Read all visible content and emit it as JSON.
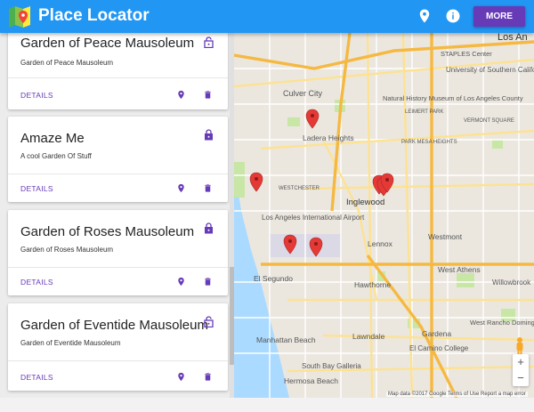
{
  "app": {
    "title": "Place Locator",
    "more_label": "MORE",
    "icons": [
      "map-logo-icon",
      "place-icon",
      "info-icon"
    ]
  },
  "cards": [
    {
      "title": "Garden of Peace Mausoleum",
      "subtitle": "Garden of Peace Mausoleum",
      "details_label": "DETAILS",
      "lock": "lock-open"
    },
    {
      "title": "Amaze Me",
      "subtitle": "A cool Garden Of Stuff",
      "details_label": "DETAILS",
      "lock": "lock"
    },
    {
      "title": "Garden of Roses Mausoleum",
      "subtitle": "Garden of Roses Mausoleum",
      "details_label": "DETAILS",
      "lock": "lock"
    },
    {
      "title": "Garden of Eventide Mausoleum",
      "subtitle": "Garden of Eventide Mausoleum",
      "details_label": "DETAILS",
      "lock": "lock-open"
    }
  ],
  "map": {
    "labels": {
      "los_angeles": "Los An",
      "university": "University of Southern California",
      "staples": "STAPLES Center",
      "culver": "Culver City",
      "nhm": "Natural History Museum of Los Angeles County",
      "ladera": "Ladera Heights",
      "inglewood": "Inglewood",
      "westchester": "WESTCHESTER",
      "lax": "Los Angeles International Airport",
      "lennox": "Lennox",
      "westmont": "Westmont",
      "elsegundo": "El Segundo",
      "hawthorne": "Hawthorne",
      "westathens": "West Athens",
      "willowbrook": "Willowbrook",
      "westrancho": "West Rancho Dominguez",
      "manhattan": "Manhattan Beach",
      "lawndale": "Lawndale",
      "gardena": "Gardena",
      "elcamino": "El Camino College",
      "southbay": "South Bay Galleria",
      "hermosa": "Hermosa Beach",
      "leimert": "LEIMERT PARK",
      "vermont": "VERMONT SQUARE",
      "parkmesa": "PARK MESA HEIGHTS"
    },
    "attribution": "Map data ©2017 Google    Terms of Use    Report a map error",
    "zoom_in": "+",
    "zoom_out": "−",
    "marker_count": 7
  },
  "colors": {
    "primary": "#2196f3",
    "accent": "#673ab7",
    "marker": "#e53935"
  }
}
